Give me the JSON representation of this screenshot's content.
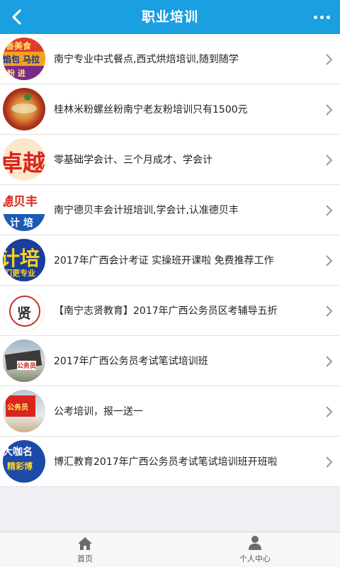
{
  "header": {
    "title": "职业培训"
  },
  "items": [
    {
      "text": "南宁专业中式餐点,西式烘焙培训,随到随学",
      "thumb_lines": [
        "香美食",
        "馅包 马拉",
        "粉 进"
      ]
    },
    {
      "text": "桂林米粉螺丝粉南宁老友粉培训只有1500元",
      "thumb_lines": []
    },
    {
      "text": "零基础学会计、三个月成才、学会计",
      "thumb_lines": [
        "卓越"
      ]
    },
    {
      "text": "南宁德贝丰会计班培训,学会计,认准德贝丰",
      "thumb_lines": [
        "德贝丰",
        "计 培"
      ]
    },
    {
      "text": "2017年广西会计考证 实操班开课啦 免费推荐工作",
      "thumb_lines": [
        "计培",
        "们更专业"
      ]
    },
    {
      "text": "【南宁志贤教育】2017年广西公务员区考辅导五折",
      "thumb_lines": [
        "贤"
      ]
    },
    {
      "text": "2017年广西公务员考试笔试培训班",
      "thumb_lines": [
        "公务员"
      ]
    },
    {
      "text": "公考培训，报一送一",
      "thumb_lines": [
        "公务员"
      ]
    },
    {
      "text": "博汇教育2017年广西公务员考试笔试培训班开班啦",
      "thumb_lines": [
        "大咖名",
        "精彩博"
      ]
    }
  ],
  "tabbar": {
    "home_label": "首页",
    "profile_label": "个人中心"
  }
}
